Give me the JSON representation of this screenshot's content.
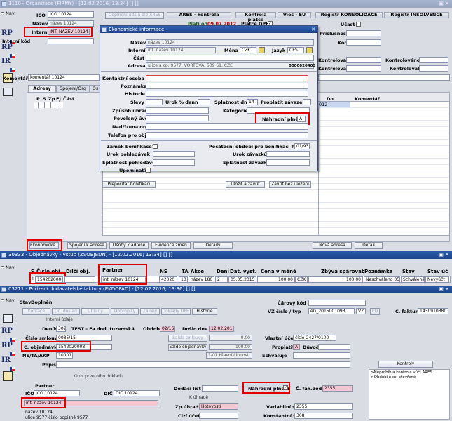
{
  "w1": {
    "title": "1110 - Organizace (FIRMY) - [12.02.2016; 13:34] [] []",
    "nav": "Nav",
    "ico_label": "IČO",
    "ico_value": "IČO 10124",
    "nazev_label": "Název",
    "nazev_value": "název 10124",
    "interni_label": "Interní",
    "interni_value": "INT. NÁZEV 10124",
    "interni_kod_label": "Interní kód",
    "ares_button": "Doplnění údajů dle ARES",
    "ares_kontrola": "ARES - kontrola",
    "plati_od": "Platí od",
    "plati_od_value": "09.07.2012",
    "kontrola_platce": "Kontrola plátce",
    "platce_dph": "Plátce DPH",
    "vies": "Vies - EU",
    "registr_konsolidace": "Registr KONSOLIDACE",
    "ucast": "Účast",
    "prislusnost": "Příslušnost",
    "kod": "Kód",
    "registr_insolvence": "Registr INSOLVENCE",
    "kontrolovano": "Kontrolováno",
    "kontroloval": "Kontroloval",
    "komentar_label": "Komentář",
    "komentar_value": "komentář 10124",
    "tabs": [
      "Adresy",
      "Spojení/Org",
      "Os"
    ],
    "grid_headers": [
      "P",
      "S",
      "Zp",
      "EJ",
      "Část"
    ],
    "do": "Do",
    "komentar_col": "Komentář",
    "grid_date": "012",
    "bottom_buttons": [
      "Ekonomické inf.",
      "Spojení k adrese",
      "Osoby k adrese",
      "Evidence změn",
      "Detaily",
      "Nová adresa",
      "Detail"
    ],
    "side": [
      "RP",
      "RP",
      "IR"
    ]
  },
  "dlg": {
    "title": "Ekonomické informace",
    "nazev_label": "Název",
    "nazev_value": "název 10124",
    "interni_label": "Interní",
    "interni_value": "int. název 10124",
    "mena_label": "Měna",
    "mena_value": "CZK",
    "jazyk_label": "Jazyk",
    "jazyk_value": "ČES",
    "cast_label": "Část",
    "adresa_label": "Adresa",
    "adresa_value": "ulice a cp. 9577, VORTOVÁ, 539 61, CZE",
    "adresa_code": "0000020403",
    "kontaktni_label": "Kontaktní osoba",
    "poznamka_label": "Poznámka",
    "historie_label": "Historie",
    "slevy_label": "Slevy",
    "urok_label": "Úrok % denně",
    "splatnost_dni_label": "Splatnost dní",
    "splatnost_dni_value": "14",
    "proplatit_label": "Proplatit závazek",
    "zpusob_label": "Způsob úhrady",
    "kategorie_label": "Kategorie",
    "povoleny_label": "Povolený úvěr",
    "nahradni_label": "Náhradní plnění",
    "nahradni_value": "A",
    "nadrizena_label": "Nadřízená org.",
    "telefon_label": "Telefon pro obj.",
    "zamek_label": "Zámek bonifikace?",
    "pocatecni_label": "Počáteční období pro bonifikaci firem",
    "pocatecni_value": "01/93",
    "urok_pohl_label": "Úrok pohledávek",
    "urok_zav_label": "Úrok závazků",
    "splat_pohl_label": "Splatnost pohledávek",
    "splat_zav_label": "Splatnost závazků",
    "upominat_label": "Upomínat?",
    "prepocitat_button": "Přepočítat bonifikaci",
    "ulozit_button": "Uložit a zavřít",
    "zavrit_button": "Zavřít bez uložení"
  },
  "w2": {
    "title": "30333 - Objednávky - vstup (ZSOBJEDN) - [12.02.2016; 13:34] [] []",
    "nav": "Nav",
    "headers": [
      "S",
      "Číslo obj.",
      "Dílčí obj.",
      "Partner",
      "NS",
      "TA",
      "Akce",
      "Dení",
      "Dat. vyst.",
      "Cena v měně",
      "Zbývá spárovat",
      "Poznámka",
      "Stav",
      "Stav úč"
    ],
    "row": {
      "s": "I",
      "cislo": "1542020008",
      "partner": "int. název 10124",
      "ns": "42020",
      "ta": "10",
      "akce": "název 180",
      "deni": "2",
      "datum": "05.05.2015",
      "cena": "100.00",
      "mena": "CZK",
      "zbyva": "100.00",
      "poznamka": "Neschváleno 05.0",
      "stav": "Schválená",
      "stav_uc": "Nevyúčt"
    }
  },
  "w3": {
    "title": "03211 - Pořízení dodavatelské faktury (EKDOFAD) - [12.02.2016; 13:36] [] []",
    "nav": "Nav",
    "stav_label": "Stav",
    "stav_value": "Doplněn",
    "carovy_label": "Čárový kód",
    "vz_label": "VZ číslo / typ",
    "vz_value": "eG_2015001093",
    "vz_type": "VZ",
    "pd": "PD",
    "faktury_label": "Č. faktury",
    "faktury_value": "1430910380",
    "buttons": [
      "Kontace",
      "Oč. doklad",
      "Úhrady",
      "Dobropisy",
      "Zálohy",
      "Doklady DPH",
      "Historie"
    ],
    "interni_udaje": "Interní údaje",
    "denik_label": "Deník",
    "denik_value": "309",
    "denik_text": "TEST - Fa dod. tuzemská",
    "obdobi_label": "Období",
    "obdobi_value": "02/16",
    "doslo_label": "Došlo dne",
    "doslo_value": "12.02.2016",
    "smlouvy_label": "Číslo smlouvy",
    "smlouvy_value": "0085/15",
    "saldo_smlouvy": "Saldo smlouvy",
    "saldo_smlouvy_value": "0.00",
    "vlastni_ucet_label": "Vlastní účet",
    "vlastni_ucet_value": "číslo-2427/0100",
    "objednavky_label": "Č. objednávky",
    "objednavky_value": "1542020008",
    "saldo_obj": "Saldo objednávky",
    "saldo_obj_value": "100.00",
    "proplatit_label": "Proplatit",
    "proplatit_value": "A",
    "duvod_label": "Důvod",
    "ns_label": "NS/TA/AKP",
    "ns_value": "10001",
    "ns_text": "1-01 Hlavní činnost",
    "schvaluje_label": "Schvaluje",
    "popis_label": "Popis",
    "opis_label": "Opis prvotního dokladu",
    "partner_label": "Partner",
    "ico_label": "IČO",
    "ico_value": "IČO 10124",
    "dic_label": "DIČ",
    "dic_value": "DIČ 10124",
    "partner_name": "int. název 10124",
    "partner_lines": [
      "název 10124",
      "ulice 9577 číslo popisné 9577"
    ],
    "dodaci_label": "Dodací list",
    "nahradni_label": "Náhradní plnění",
    "fak_dod_label": "Č. fak.dod",
    "fak_dod_value": "2355",
    "k_uhrade": "K úhradě",
    "zp_uhrady_label": "Zp.úhrady",
    "zp_uhrady_value": "Hotovostí",
    "variabilni_label": "Variabilní s.",
    "variabilni_value": "2355",
    "cizi_ucet_label": "Cizí účet",
    "konstantni_label": "Konstantní s.",
    "konstantni_value": "308",
    "kontroly_button": "Kontroly",
    "kontroly_lines": [
      ">Neprobíhla kontrola vůči ARES",
      ">Období není otevřené"
    ]
  }
}
